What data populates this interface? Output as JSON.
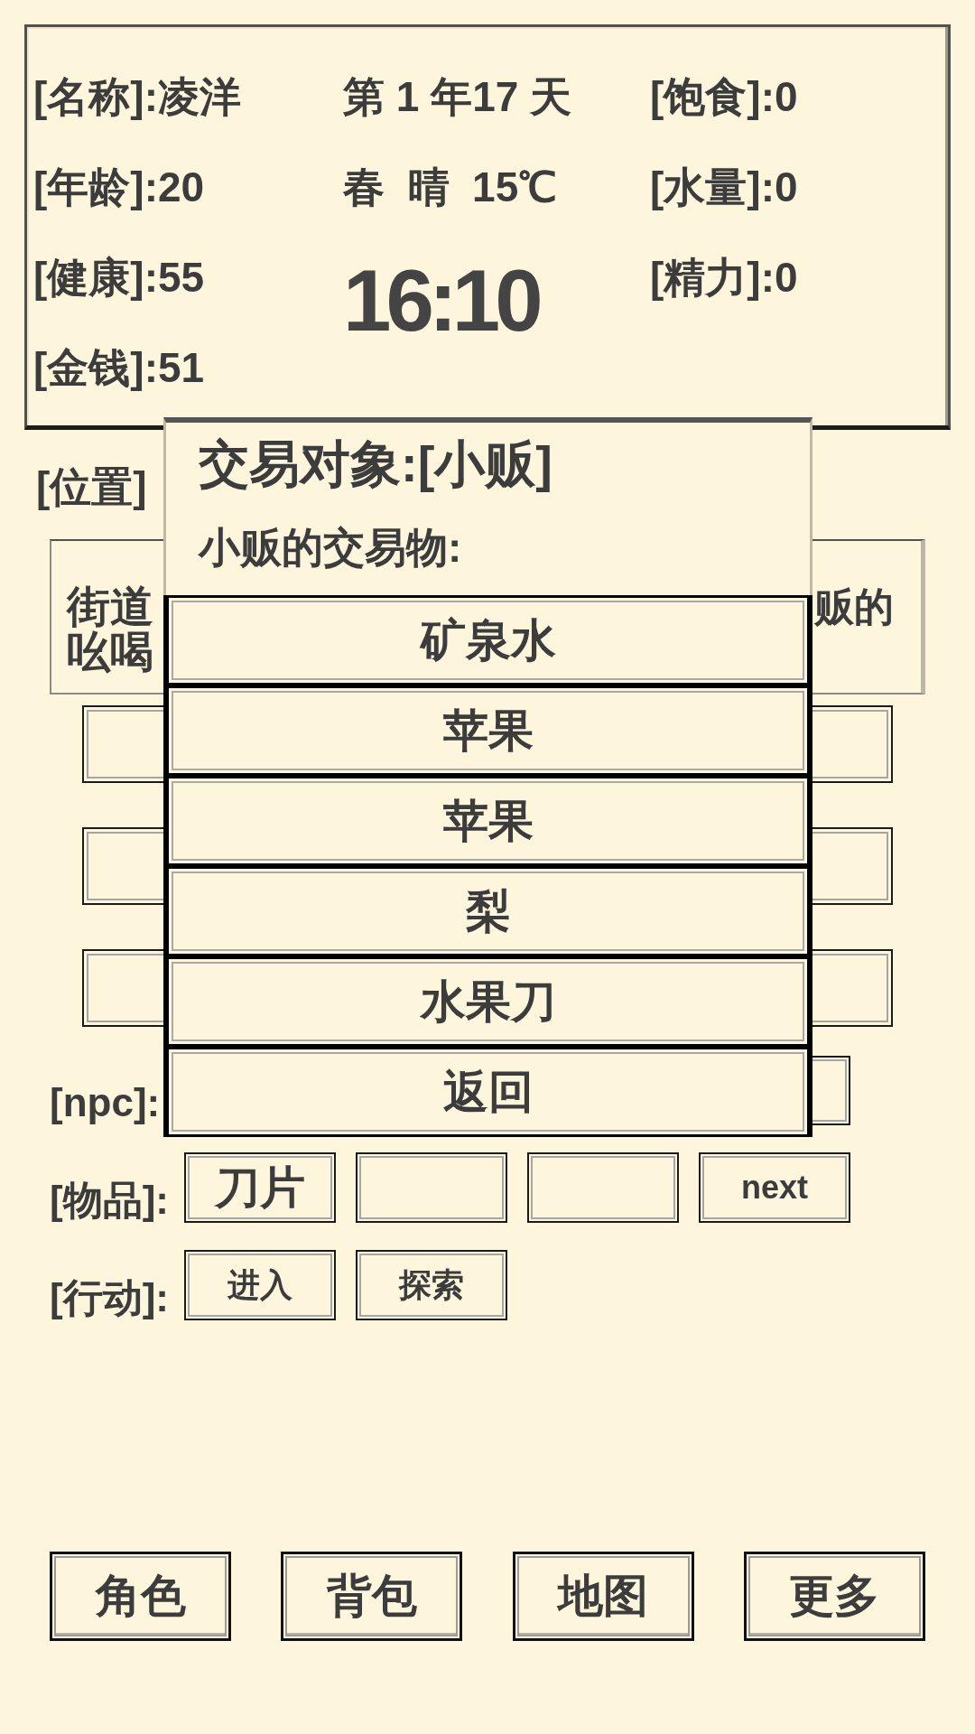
{
  "status_panel": {
    "left_stats": [
      "[名称]:凌洋",
      "[年龄]:20",
      "[健康]:55",
      "[金钱]:51"
    ],
    "date": "第 1 年17 天",
    "weather": "春  晴  15℃",
    "clock": "16:10",
    "right_stats": [
      "[饱食]:0",
      "[水量]:0",
      "[精力]:0"
    ]
  },
  "location": {
    "label": "[位置]"
  },
  "description_cards": [
    {
      "lines": [
        "街道",
        "吆喝"
      ]
    },
    {
      "lines": [
        "贩的"
      ]
    }
  ],
  "npc_row": {
    "label": "[npc]:"
  },
  "items_row": {
    "label": "[物品]:",
    "slots": [
      {
        "kind": "item",
        "label": "刀片"
      },
      {
        "kind": "empty"
      },
      {
        "kind": "empty"
      },
      {
        "kind": "next",
        "label": "next"
      }
    ]
  },
  "actions_row": {
    "label": "[行动]:",
    "buttons": [
      "进入",
      "探索"
    ]
  },
  "trade_dialog": {
    "title": "交易对象:[小贩]",
    "subtitle": "小贩的交易物:",
    "options": [
      "矿泉水",
      "苹果",
      "苹果",
      "梨",
      "水果刀",
      "返回"
    ]
  },
  "bottom_nav": [
    "角色",
    "背包",
    "地图",
    "更多"
  ]
}
